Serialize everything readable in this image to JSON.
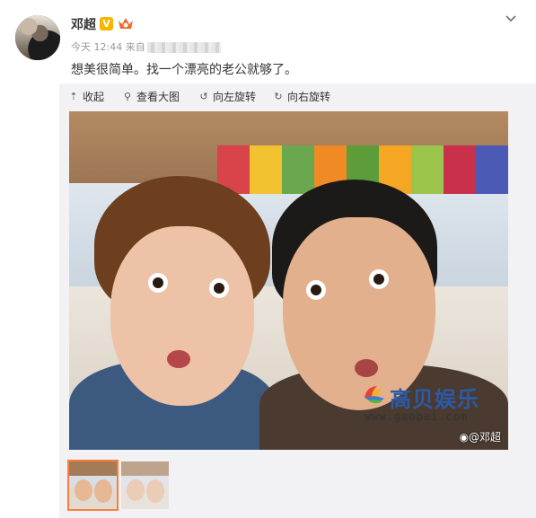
{
  "post": {
    "author": "邓超",
    "verified_badge": "V",
    "time": "今天 12:44",
    "source_prefix": "来自",
    "text": "想美很简单。找一个漂亮的老公就够了。",
    "menu_icon": "chevron-down-icon"
  },
  "toolbar": {
    "collapse": "收起",
    "view_large": "查看大图",
    "rotate_left": "向左旋转",
    "rotate_right": "向右旋转"
  },
  "photo": {
    "watermark": "@邓超",
    "thumbnails_count": 2,
    "selected_index": 0
  },
  "brand": {
    "name": "高贝娱乐",
    "url": "www.gaobei.com"
  },
  "colors": {
    "accent": "#fa7d3c",
    "verified": "#f7b500",
    "brand_blue": "#2b5aa8"
  }
}
